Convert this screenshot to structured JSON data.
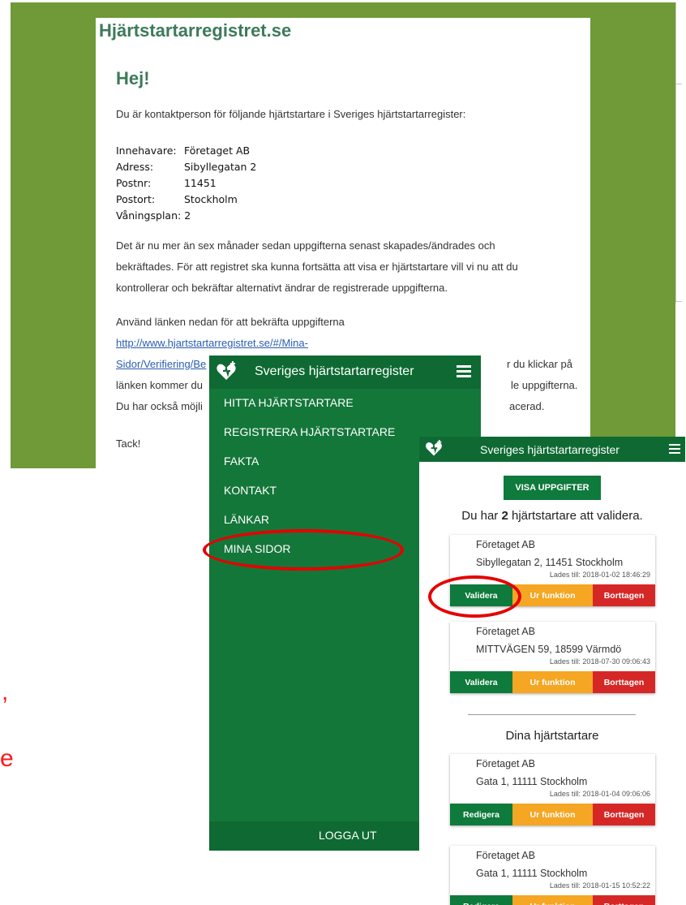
{
  "email": {
    "site_title": "Hjärtstartarregistret.se",
    "greeting": "Hej!",
    "intro": "Du är kontaktperson för följande hjärtstartare i Sveriges hjärtstartarregister:",
    "details": [
      {
        "label": "Innehavare:",
        "value": "Företaget AB"
      },
      {
        "label": "Adress:",
        "value": "Sibyllegatan 2"
      },
      {
        "label": "Postnr:",
        "value": "11451"
      },
      {
        "label": "Postort:",
        "value": "Stockholm"
      },
      {
        "label": "Våningsplan:",
        "value": "2"
      }
    ],
    "para1_lines": [
      "Det är nu mer än sex månader sedan uppgifterna senast skapades/ändrades och",
      "bekräftades. För att registret ska kunna fortsätta att visa er hjärtstartare vill vi nu att du",
      "kontrollerar och bekräftar alternativt ändrar de registrerade uppgifterna."
    ],
    "link_intro": "Använd länken nedan för att bekräfta uppgifterna",
    "link_line1": "http://www.hjartstartarregistret.se/#/Mina-",
    "link_line2": "Sidor/Verifiering/Be",
    "after_link_visible": "r du klickar på",
    "line_lanken_left": "länken kommer du",
    "line_lanken_right": "le uppgifterna.",
    "line_mojlighet_left": "Du har också möjli",
    "line_mojlighet_right": "acerad.",
    "thanks": "Tack!"
  },
  "menu_phone": {
    "title": "Sveriges hjärtstartarregister",
    "items": [
      "HITTA HJÄRTSTARTARE",
      "REGISTRERA HJÄRTSTARTARE",
      "FAKTA",
      "KONTAKT",
      "LÄNKAR",
      "MINA SIDOR"
    ],
    "logout": "LOGGA UT"
  },
  "right_phone": {
    "title": "Sveriges hjärtstartarregister",
    "visa_button": "VISA UPPGIFTER",
    "count_prefix": "Du har ",
    "count": "2",
    "count_suffix": " hjärtstartare att validera.",
    "validate_cards": [
      {
        "owner": "Företaget AB",
        "address": "Sibyllegatan 2, 11451 Stockholm",
        "loaded": "Lades till: 2018-01-02 18:46:29",
        "btn_primary": "Validera",
        "btn_mid": "Ur funktion",
        "btn_remove": "Borttagen"
      },
      {
        "owner": "Företaget AB",
        "address": "MITTVÄGEN 59, 18599 Värmdö",
        "loaded": "Lades till: 2018-07-30 09:06:43",
        "btn_primary": "Validera",
        "btn_mid": "Ur funktion",
        "btn_remove": "Borttagen"
      }
    ],
    "section_title": "Dina hjärtstartare",
    "own_cards": [
      {
        "owner": "Företaget AB",
        "address": "Gata 1, 11111 Stockholm",
        "loaded": "Lades till: 2018-01-04 09:06:06",
        "btn_primary": "Redigera",
        "btn_mid": "Ur funktion",
        "btn_remove": "Borttagen"
      },
      {
        "owner": "Företaget AB",
        "address": "Gata 1, 11111 Stockholm",
        "loaded": "Lades till: 2018-01-15 10:52:22",
        "btn_primary": "Redigera",
        "btn_mid": "Ur funktion",
        "btn_remove": "Borttagen"
      }
    ]
  },
  "annotation_fragments": [
    ",",
    "e"
  ],
  "colors": {
    "brand_green": "#0e7a3c",
    "olive_bg": "#6f9a37",
    "title_green": "#3d7a5a",
    "orange": "#f5a623",
    "red": "#d62727",
    "annotation_red": "#e50000"
  }
}
